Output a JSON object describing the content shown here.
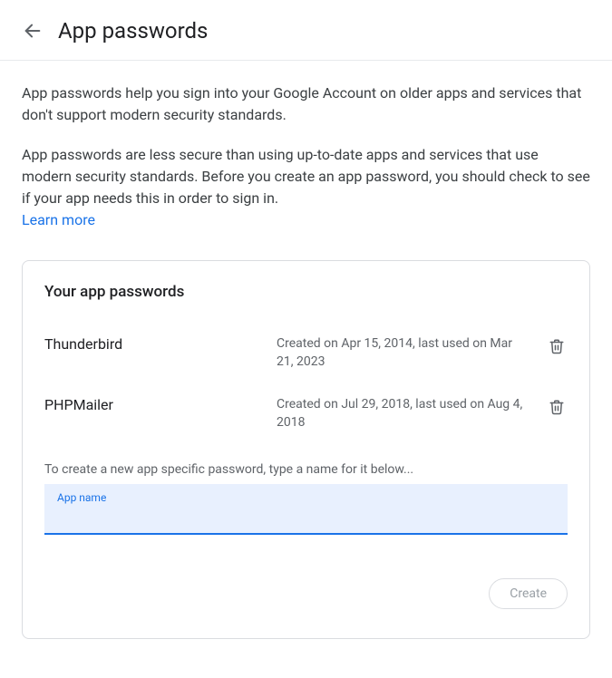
{
  "header": {
    "title": "App passwords"
  },
  "intro": {
    "para1": "App passwords help you sign into your Google Account on older apps and services that don't support modern security standards.",
    "para2": "App passwords are less secure than using up-to-date apps and services that use modern security standards. Before you create an app password, you should check to see if your app needs this in order to sign in.",
    "learn_more": "Learn more"
  },
  "card": {
    "title": "Your app passwords",
    "items": [
      {
        "name": "Thunderbird",
        "meta": "Created on Apr 15, 2014, last used on Mar 21, 2023"
      },
      {
        "name": "PHPMailer",
        "meta": "Created on Jul 29, 2018, last used on Aug 4, 2018"
      }
    ],
    "create_hint": "To create a new app specific password, type a name for it below...",
    "input_label": "App name",
    "input_value": "",
    "create_button": "Create"
  }
}
